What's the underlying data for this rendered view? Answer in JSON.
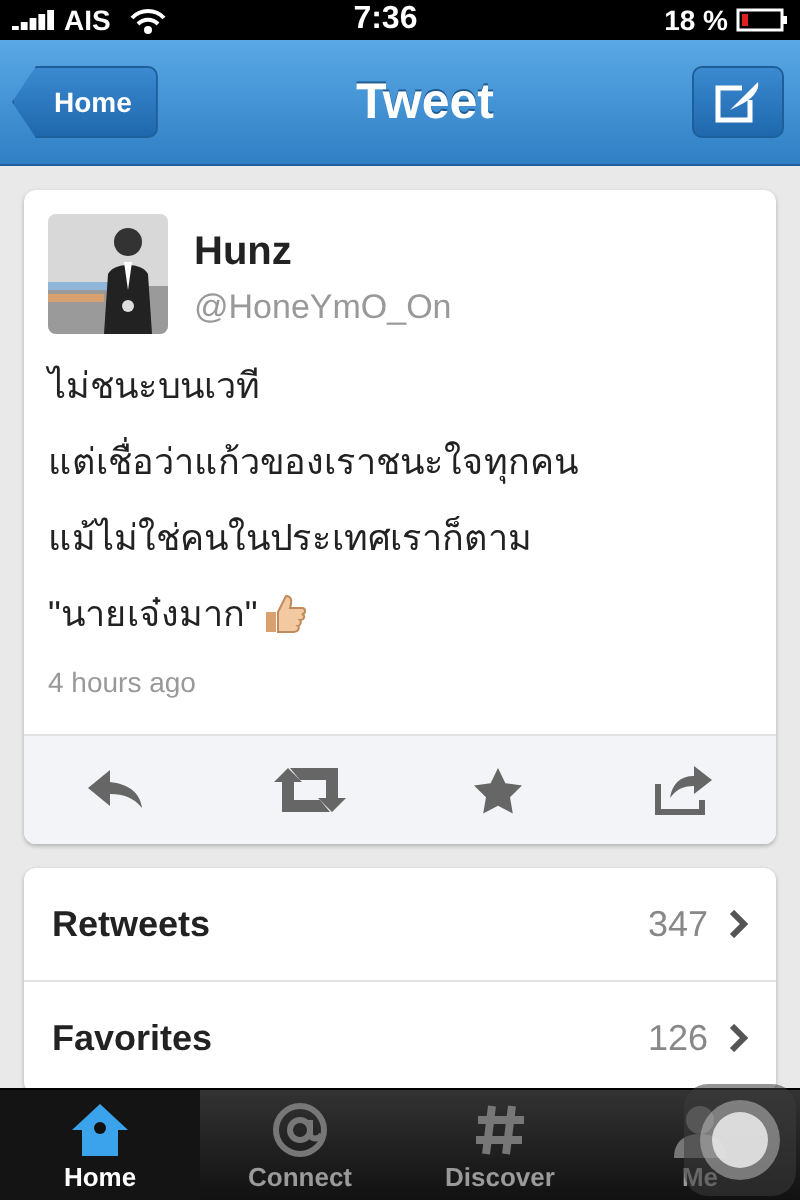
{
  "status_bar": {
    "carrier": "AIS",
    "time": "7:36",
    "battery": "18 %"
  },
  "nav": {
    "back": "Home",
    "title": "Tweet"
  },
  "tweet": {
    "name": "Hunz",
    "handle": "@HoneYmO_On",
    "lines": [
      {
        "text": "ไม่ชนะบนเวที",
        "emoji": false
      },
      {
        "text": "แต่เชื่อว่าแก้วของเราชนะใจทุกคน",
        "emoji": false
      },
      {
        "text": "แม้ไม่ใช่คนในประเทศเราก็ตาม",
        "emoji": false
      },
      {
        "text": "\"นายเจ๋งมาก\"",
        "emoji": true
      }
    ],
    "time": "4 hours ago"
  },
  "stats": [
    {
      "label": "Retweets",
      "count": "347"
    },
    {
      "label": "Favorites",
      "count": "126"
    }
  ],
  "tabs": [
    {
      "label": "Home",
      "selected": true
    },
    {
      "label": "Connect",
      "selected": false
    },
    {
      "label": "Discover",
      "selected": false
    },
    {
      "label": "Me",
      "selected": false
    }
  ]
}
